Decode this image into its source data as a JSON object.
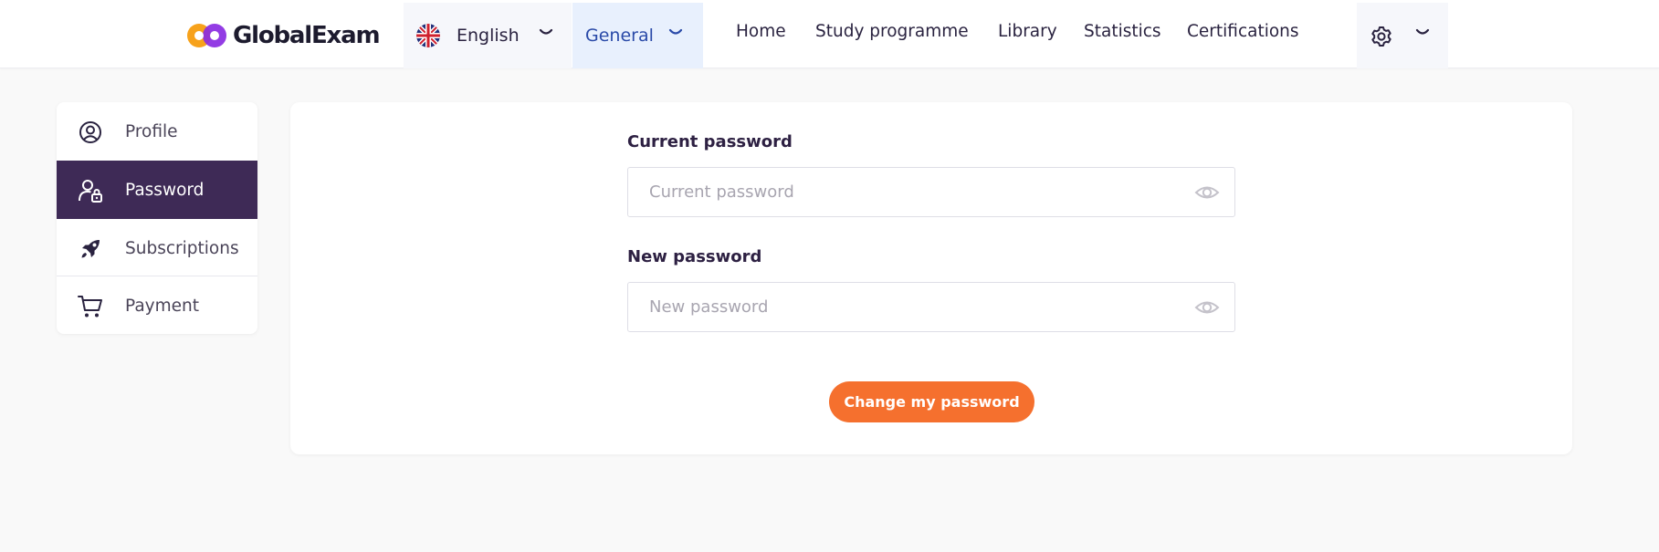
{
  "brand": {
    "name": "GlobalExam",
    "colors": {
      "primary": "#3e2a56",
      "accent": "#f5702e",
      "logo_orange": "#f7a21b",
      "logo_purple": "#8a2be2"
    }
  },
  "header": {
    "language": {
      "label": "English",
      "flag_icon": "uk-flag-icon"
    },
    "category": {
      "label": "General"
    },
    "nav": [
      "Home",
      "Study programme",
      "Library",
      "Statistics",
      "Certifications"
    ],
    "settings_icon": "gear-icon"
  },
  "sidebar": {
    "items": [
      {
        "label": "Profile",
        "icon": "user-circle-icon",
        "active": false
      },
      {
        "label": "Password",
        "icon": "user-lock-icon",
        "active": true
      },
      {
        "label": "Subscriptions",
        "icon": "rocket-icon",
        "active": false
      },
      {
        "label": "Payment",
        "icon": "cart-icon",
        "active": false
      }
    ]
  },
  "form": {
    "current_password": {
      "label": "Current password",
      "placeholder": "Current password",
      "value": ""
    },
    "new_password": {
      "label": "New password",
      "placeholder": "New password",
      "value": ""
    },
    "submit_label": "Change my password"
  }
}
